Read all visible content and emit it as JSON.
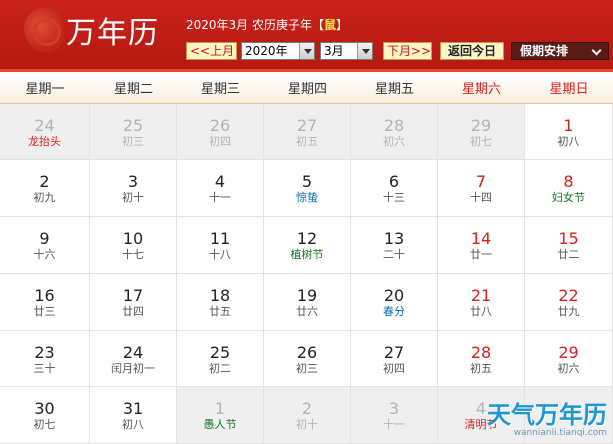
{
  "header": {
    "logo_text": "万年历",
    "lunar_prefix": "2020年3月 农历庚子年【",
    "zodiac": "鼠",
    "lunar_suffix": "】",
    "prev_month_label": "<<上月",
    "year_select": "2020年",
    "month_select": "3月",
    "next_month_label": "下月>>",
    "today_label": "返回今日",
    "holiday_label": "假期安排"
  },
  "weekdays": [
    "星期一",
    "星期二",
    "星期三",
    "星期四",
    "星期五",
    "星期六",
    "星期日"
  ],
  "weeks": [
    [
      {
        "day": "24",
        "sub": "龙抬头",
        "other": true,
        "kind": "red"
      },
      {
        "day": "25",
        "sub": "初三",
        "other": true
      },
      {
        "day": "26",
        "sub": "初四",
        "other": true
      },
      {
        "day": "27",
        "sub": "初五",
        "other": true
      },
      {
        "day": "28",
        "sub": "初六",
        "other": true
      },
      {
        "day": "29",
        "sub": "初七",
        "other": true
      },
      {
        "day": "1",
        "sub": "初八",
        "weekend": true
      }
    ],
    [
      {
        "day": "2",
        "sub": "初九"
      },
      {
        "day": "3",
        "sub": "初十"
      },
      {
        "day": "4",
        "sub": "十一"
      },
      {
        "day": "5",
        "sub": "惊蛰",
        "kind": "term"
      },
      {
        "day": "6",
        "sub": "十三"
      },
      {
        "day": "7",
        "sub": "十四",
        "weekend": true
      },
      {
        "day": "8",
        "sub": "妇女节",
        "weekend": true,
        "kind": "festival"
      }
    ],
    [
      {
        "day": "9",
        "sub": "十六"
      },
      {
        "day": "10",
        "sub": "十七"
      },
      {
        "day": "11",
        "sub": "十八"
      },
      {
        "day": "12",
        "sub": "植树节",
        "kind": "festival"
      },
      {
        "day": "13",
        "sub": "二十"
      },
      {
        "day": "14",
        "sub": "廿一",
        "weekend": true
      },
      {
        "day": "15",
        "sub": "廿二",
        "weekend": true
      }
    ],
    [
      {
        "day": "16",
        "sub": "廿三"
      },
      {
        "day": "17",
        "sub": "廿四"
      },
      {
        "day": "18",
        "sub": "廿五"
      },
      {
        "day": "19",
        "sub": "廿六"
      },
      {
        "day": "20",
        "sub": "春分",
        "kind": "term"
      },
      {
        "day": "21",
        "sub": "廿八",
        "weekend": true
      },
      {
        "day": "22",
        "sub": "廿九",
        "weekend": true
      }
    ],
    [
      {
        "day": "23",
        "sub": "三十"
      },
      {
        "day": "24",
        "sub": "闰月初一"
      },
      {
        "day": "25",
        "sub": "初二"
      },
      {
        "day": "26",
        "sub": "初三"
      },
      {
        "day": "27",
        "sub": "初四"
      },
      {
        "day": "28",
        "sub": "初五",
        "weekend": true
      },
      {
        "day": "29",
        "sub": "初六",
        "weekend": true
      }
    ],
    [
      {
        "day": "30",
        "sub": "初七"
      },
      {
        "day": "31",
        "sub": "初八"
      },
      {
        "day": "1",
        "sub": "愚人节",
        "other": true,
        "kind": "festival"
      },
      {
        "day": "2",
        "sub": "初十",
        "other": true
      },
      {
        "day": "3",
        "sub": "十一",
        "other": true
      },
      {
        "day": "4",
        "sub": "清明节",
        "other": true,
        "kind": "red"
      },
      {
        "day": "",
        "sub": "",
        "other": true
      }
    ]
  ],
  "watermark": {
    "brand": "天气万年历",
    "url": "wannianli.tianqi.com"
  }
}
